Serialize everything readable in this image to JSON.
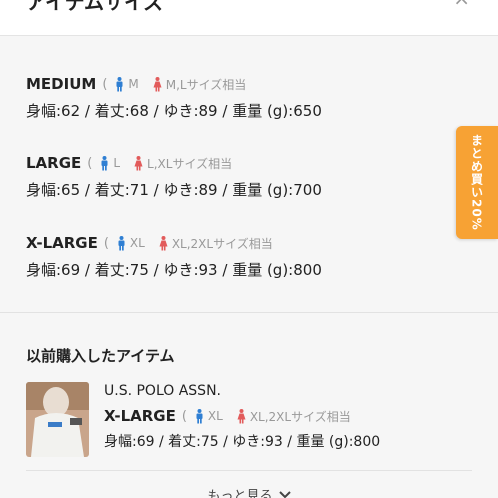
{
  "header": {
    "title": "アイテムサイズ",
    "close_glyph": "×"
  },
  "sizes": [
    {
      "name": "MEDIUM",
      "male_size": "M",
      "female_size": "M,Lサイズ相当",
      "detail": "身幅:62 / 着丈:68 / ゆき:89 / 重量 (g):650"
    },
    {
      "name": "LARGE",
      "male_size": "L",
      "female_size": "L,XLサイズ相当",
      "detail": "身幅:65 / 着丈:71 / ゆき:89 / 重量 (g):700"
    },
    {
      "name": "X-LARGE",
      "male_size": "XL",
      "female_size": "XL,2XLサイズ相当",
      "detail": "身幅:69 / 着丈:75 / ゆき:93 / 重量 (g):800"
    }
  ],
  "paren_open": "(",
  "history": {
    "title": "以前購入したアイテム",
    "item": {
      "brand": "U.S. POLO ASSN.",
      "size_name": "X-LARGE",
      "male_size": "XL",
      "female_size": "XL,2XLサイズ相当",
      "detail": "身幅:69 / 着丈:75 / ゆき:93 / 重量 (g):800"
    },
    "more_label": "もっと見る"
  },
  "promo_tab": {
    "label": "まとめ買い20%"
  },
  "colors": {
    "male": "#2f7fd3",
    "female": "#e25b5b",
    "promo": "#f7a234"
  },
  "icons": [
    "male-icon",
    "female-icon",
    "close-icon",
    "chevron-down-icon"
  ]
}
